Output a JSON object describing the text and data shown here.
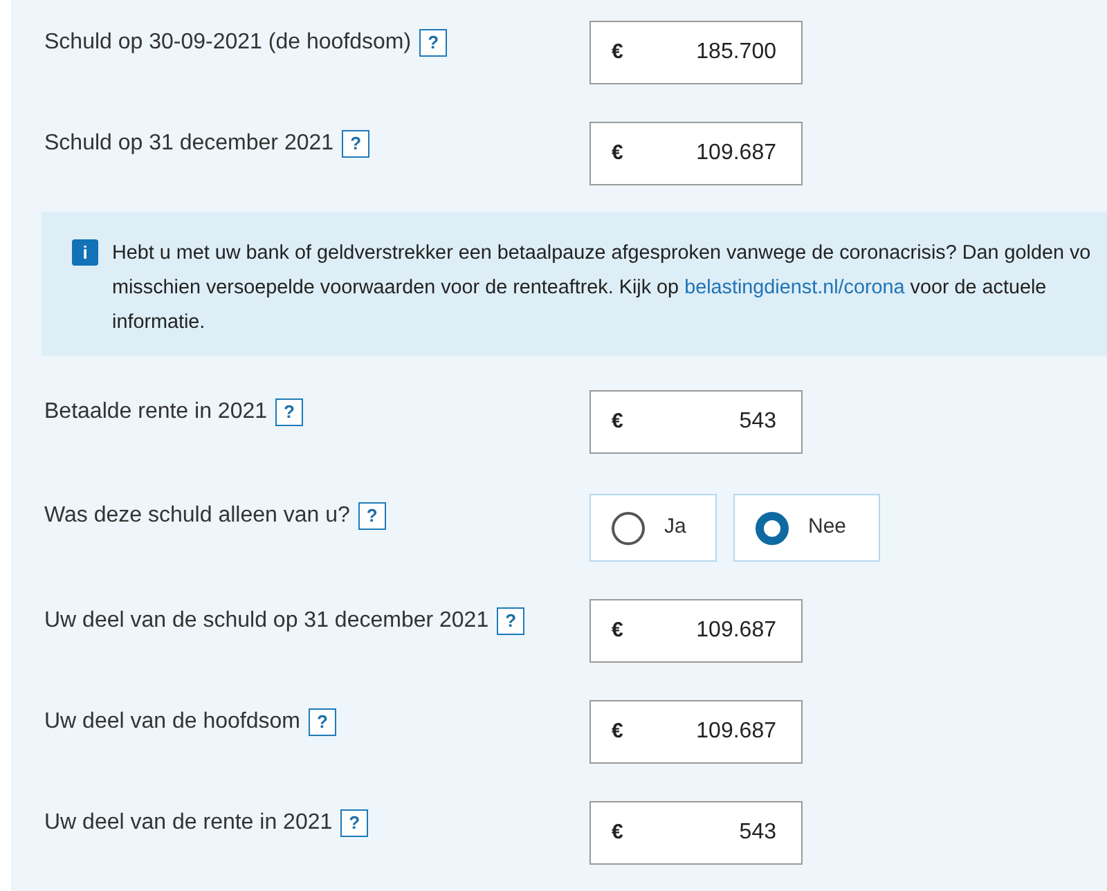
{
  "rows_before": [
    {
      "kind": "amount",
      "label": "Schuld op 30-09-2021 (de hoofdsom)",
      "help": "?",
      "currency": "€",
      "value": "185.700"
    },
    {
      "kind": "amount",
      "label": "Schuld op 31 december 2021",
      "help": "?",
      "currency": "€",
      "value": "109.687"
    }
  ],
  "info": {
    "icon": "i",
    "lines": [
      [
        {
          "text": "Hebt u met uw bank of geldverstrekker een betaalpauze afgesproken vanwege de coronacrisis? Dan golden vo"
        }
      ],
      [
        {
          "text": "misschien versoepelde voorwaarden voor de renteaftrek. Kijk op "
        },
        {
          "text": "belastingdienst.nl/corona",
          "kind": "link"
        },
        {
          "text": " voor de actuele"
        }
      ],
      [
        {
          "text": "informatie."
        }
      ]
    ]
  },
  "rows_after": [
    {
      "kind": "amount",
      "label": "Betaalde rente in 2021",
      "help": "?",
      "currency": "€",
      "value": "543"
    },
    {
      "kind": "radio",
      "label": "Was deze schuld alleen van u?",
      "help": "?",
      "options": [
        {
          "label": "Ja",
          "selected": false
        },
        {
          "label": "Nee",
          "selected": true
        }
      ]
    },
    {
      "kind": "amount",
      "label": "Uw deel van de schuld op 31 december 2021",
      "help": "?",
      "currency": "€",
      "value": "109.687"
    },
    {
      "kind": "amount",
      "label": "Uw deel van de hoofdsom",
      "help": "?",
      "currency": "€",
      "value": "109.687"
    },
    {
      "kind": "amount",
      "label": "Uw deel van de rente in 2021",
      "help": "?",
      "currency": "€",
      "value": "543"
    }
  ]
}
